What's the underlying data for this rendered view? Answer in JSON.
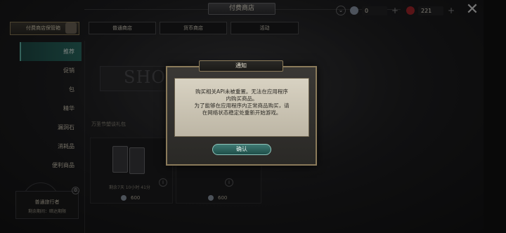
{
  "header": {
    "title": "付费商店",
    "currencies": [
      {
        "icon": "diamond-gem-icon",
        "value": "0"
      },
      {
        "icon": "red-gem-icon",
        "value": "221"
      }
    ],
    "plus_symbol": "+",
    "close_symbol": "✕",
    "down_arrow": "⌄"
  },
  "sidebar": {
    "guard_button": "付费商店保管箱",
    "items": [
      {
        "label": "推荐",
        "active": true
      },
      {
        "label": "促销",
        "active": false
      },
      {
        "label": "包",
        "active": false
      },
      {
        "label": "精华",
        "active": false
      },
      {
        "label": "漏洞石",
        "active": false
      },
      {
        "label": "消耗品",
        "active": false
      },
      {
        "label": "便利商品",
        "active": false
      }
    ]
  },
  "tabs": [
    "普通商店",
    "货币商店",
    "活动"
  ],
  "background": {
    "banner_text": "SHO",
    "section_label": "万圣节塑谈礼包",
    "card_timer": "剩余7天 10小时 41分",
    "prices": [
      "600",
      "600"
    ]
  },
  "character": {
    "name": "普通旅行者",
    "remaining": "剩余期间：暗达期限"
  },
  "dialog": {
    "title": "通知",
    "message_lines": [
      "购买相关API未被重置。无法在应用程序",
      "内购买商品。",
      "为了能够在应用程序内正常商品购买，请",
      "在网络状态稳定处重新开始游戏。"
    ],
    "confirm": "确认"
  },
  "colors": {
    "accent_teal": "#2a6a62",
    "dialog_border": "#8a7a5a",
    "paper": "#d8d2c2"
  }
}
